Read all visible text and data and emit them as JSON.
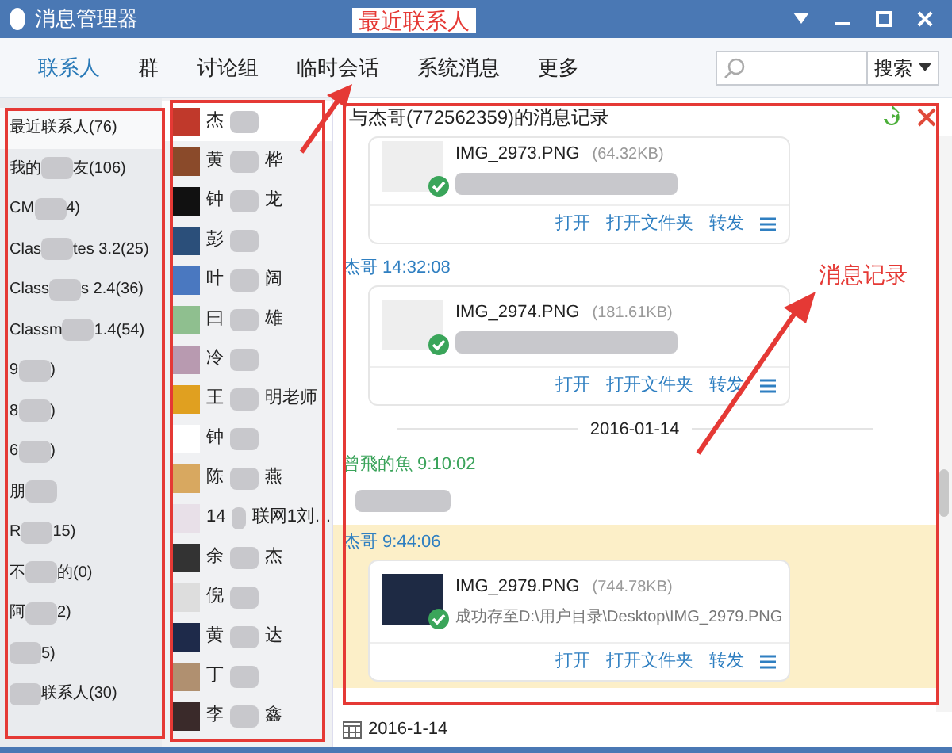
{
  "window": {
    "title": "消息管理器"
  },
  "tabs": [
    {
      "label": "联系人",
      "selected": true
    },
    {
      "label": "群",
      "selected": false
    },
    {
      "label": "讨论组",
      "selected": false
    },
    {
      "label": "临时会话",
      "selected": false
    },
    {
      "label": "系统消息",
      "selected": false
    },
    {
      "label": "更多",
      "selected": false
    }
  ],
  "search": {
    "button": "搜索"
  },
  "groups": [
    {
      "prefix": "最近联系人(76)",
      "selected": true
    },
    {
      "prefix": "我的",
      "suffix": "友(106)",
      "selected": false
    },
    {
      "prefix": "CM",
      "suffix": "4)",
      "selected": false
    },
    {
      "prefix": "Clas",
      "suffix": "tes 3.2(25)",
      "selected": false
    },
    {
      "prefix": "Class",
      "suffix": "s 2.4(36)",
      "selected": false
    },
    {
      "prefix": "Classm",
      "suffix": "1.4(54)",
      "selected": false
    },
    {
      "prefix": "9",
      "suffix": ")",
      "selected": false
    },
    {
      "prefix": "8",
      "suffix": ")",
      "selected": false
    },
    {
      "prefix": "6",
      "suffix": ")",
      "selected": false
    },
    {
      "prefix": "朋",
      "selected": false
    },
    {
      "prefix": "R",
      "suffix": "15)",
      "selected": false
    },
    {
      "prefix": "不",
      "suffix": "的(0)",
      "selected": false
    },
    {
      "prefix": "阿",
      "suffix": "2)",
      "selected": false
    },
    {
      "suffix": "5)",
      "selected": false
    },
    {
      "suffix": "联系人(30)",
      "selected": false
    }
  ],
  "contacts": [
    {
      "prefix": "杰",
      "color": "#c0392b",
      "selected": true
    },
    {
      "prefix": "黄",
      "suffix": "桦",
      "color": "#8a4a2a",
      "selected": false
    },
    {
      "prefix": "钟",
      "suffix": "龙",
      "color": "#111111",
      "selected": false
    },
    {
      "prefix": "彭",
      "color": "#2b4f7a",
      "selected": false
    },
    {
      "prefix": "叶",
      "suffix": "阔",
      "color": "#4a78c0",
      "selected": false
    },
    {
      "prefix": "曰",
      "suffix": "雄",
      "color": "#8fbf8f",
      "selected": false
    },
    {
      "prefix": "冷",
      "color": "#b89ab0",
      "selected": false
    },
    {
      "prefix": "王",
      "suffix": "明老师",
      "color": "#e0a020",
      "selected": false
    },
    {
      "prefix": "钟",
      "color": "#ffffff",
      "selected": false
    },
    {
      "prefix": "陈",
      "suffix": "燕",
      "color": "#d8a860",
      "selected": false
    },
    {
      "prefix": "14",
      "suffix": "联网1刘…",
      "color": "#e8e0e8",
      "selected": false
    },
    {
      "prefix": "余",
      "suffix": "杰",
      "color": "#333333",
      "selected": false
    },
    {
      "prefix": "倪",
      "color": "#dddddd",
      "selected": false
    },
    {
      "prefix": "黄",
      "suffix": "达",
      "color": "#1e2a4a",
      "selected": false
    },
    {
      "prefix": "丁",
      "color": "#b09070",
      "selected": false
    },
    {
      "prefix": "李",
      "suffix": "鑫",
      "color": "#3a2a2a",
      "selected": false
    }
  ],
  "chat": {
    "title": "与杰哥(772562359)的消息记录",
    "messages": [
      {
        "kind": "file",
        "selected": false,
        "filename": "IMG_2973.PNG",
        "size": "(64.32KB)",
        "actions": [
          "打开",
          "打开文件夹",
          "转发"
        ]
      },
      {
        "kind": "file",
        "sender": "杰哥",
        "time": "14:32:08",
        "color": "#2f7fc1",
        "selected": false,
        "filename": "IMG_2974.PNG",
        "size": "(181.61KB)",
        "actions": [
          "打开",
          "打开文件夹",
          "转发"
        ]
      },
      {
        "kind": "date",
        "text": "2016-01-14"
      },
      {
        "kind": "text",
        "sender": "曾飛的魚",
        "time": "9:10:02",
        "color": "#3aa35a",
        "selected": false
      },
      {
        "kind": "file",
        "sender": "杰哥",
        "time": "9:44:06",
        "color": "#2f7fc1",
        "selected": true,
        "filename": "IMG_2979.PNG",
        "size": "(744.78KB)",
        "status": "成功存至D:\\用户目录\\Desktop\\IMG_2979.PNG",
        "actions": [
          "打开",
          "打开文件夹",
          "转发"
        ]
      }
    ],
    "date": "2016-1-14"
  },
  "annotations": [
    "最近联系人",
    "消息记录"
  ]
}
